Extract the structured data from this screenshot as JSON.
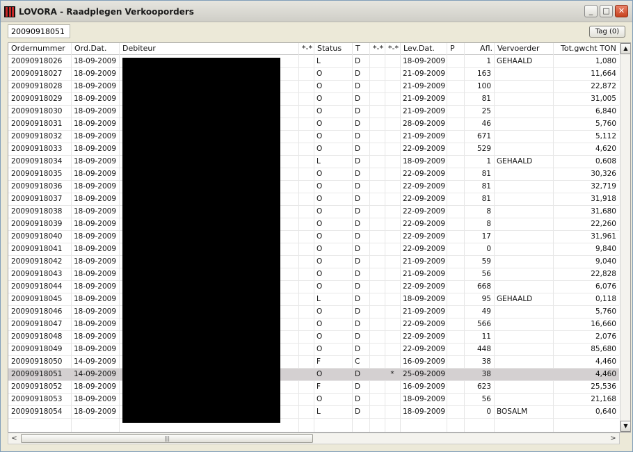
{
  "window": {
    "title": "LOVORA - Raadplegen Verkooporders",
    "min_label": "_",
    "max_label": "□",
    "close_label": "✕"
  },
  "search": {
    "value": "20090918051"
  },
  "toolbar": {
    "tag_label": "Tag (0)"
  },
  "columns": [
    "Ordernummer",
    "Ord.Dat.",
    "Debiteur",
    "*-*",
    "Status",
    "T",
    "*-*",
    "*-*",
    "Lev.Dat.",
    "P",
    "Afl.",
    "Vervoerder",
    "Tot.gwcht TON"
  ],
  "rows": [
    {
      "ordernummer": "20090918026",
      "orddat": "18-09-2009",
      "status": "L",
      "t": "D",
      "mark": "",
      "levdat": "18-09-2009",
      "afl": "1",
      "vervoerder": "GEHAALD",
      "gewicht": "1,080"
    },
    {
      "ordernummer": "20090918027",
      "orddat": "18-09-2009",
      "status": "O",
      "t": "D",
      "mark": "",
      "levdat": "21-09-2009",
      "afl": "163",
      "vervoerder": "",
      "gewicht": "11,664"
    },
    {
      "ordernummer": "20090918028",
      "orddat": "18-09-2009",
      "status": "O",
      "t": "D",
      "mark": "",
      "levdat": "21-09-2009",
      "afl": "100",
      "vervoerder": "",
      "gewicht": "22,872"
    },
    {
      "ordernummer": "20090918029",
      "orddat": "18-09-2009",
      "status": "O",
      "t": "D",
      "mark": "",
      "levdat": "21-09-2009",
      "afl": "81",
      "vervoerder": "",
      "gewicht": "31,005"
    },
    {
      "ordernummer": "20090918030",
      "orddat": "18-09-2009",
      "status": "O",
      "t": "D",
      "mark": "",
      "levdat": "21-09-2009",
      "afl": "25",
      "vervoerder": "",
      "gewicht": "6,840"
    },
    {
      "ordernummer": "20090918031",
      "orddat": "18-09-2009",
      "status": "O",
      "t": "D",
      "mark": "",
      "levdat": "28-09-2009",
      "afl": "46",
      "vervoerder": "",
      "gewicht": "5,760"
    },
    {
      "ordernummer": "20090918032",
      "orddat": "18-09-2009",
      "status": "O",
      "t": "D",
      "mark": "",
      "levdat": "21-09-2009",
      "afl": "671",
      "vervoerder": "",
      "gewicht": "5,112"
    },
    {
      "ordernummer": "20090918033",
      "orddat": "18-09-2009",
      "status": "O",
      "t": "D",
      "mark": "",
      "levdat": "22-09-2009",
      "afl": "529",
      "vervoerder": "",
      "gewicht": "4,620"
    },
    {
      "ordernummer": "20090918034",
      "orddat": "18-09-2009",
      "status": "L",
      "t": "D",
      "mark": "",
      "levdat": "18-09-2009",
      "afl": "1",
      "vervoerder": "GEHAALD",
      "gewicht": "0,608"
    },
    {
      "ordernummer": "20090918035",
      "orddat": "18-09-2009",
      "status": "O",
      "t": "D",
      "mark": "",
      "levdat": "22-09-2009",
      "afl": "81",
      "vervoerder": "",
      "gewicht": "30,326"
    },
    {
      "ordernummer": "20090918036",
      "orddat": "18-09-2009",
      "status": "O",
      "t": "D",
      "mark": "",
      "levdat": "22-09-2009",
      "afl": "81",
      "vervoerder": "",
      "gewicht": "32,719"
    },
    {
      "ordernummer": "20090918037",
      "orddat": "18-09-2009",
      "status": "O",
      "t": "D",
      "mark": "",
      "levdat": "22-09-2009",
      "afl": "81",
      "vervoerder": "",
      "gewicht": "31,918"
    },
    {
      "ordernummer": "20090918038",
      "orddat": "18-09-2009",
      "status": "O",
      "t": "D",
      "mark": "",
      "levdat": "22-09-2009",
      "afl": "8",
      "vervoerder": "",
      "gewicht": "31,680"
    },
    {
      "ordernummer": "20090918039",
      "orddat": "18-09-2009",
      "status": "O",
      "t": "D",
      "mark": "",
      "levdat": "22-09-2009",
      "afl": "8",
      "vervoerder": "",
      "gewicht": "22,260"
    },
    {
      "ordernummer": "20090918040",
      "orddat": "18-09-2009",
      "status": "O",
      "t": "D",
      "mark": "",
      "levdat": "22-09-2009",
      "afl": "17",
      "vervoerder": "",
      "gewicht": "31,961"
    },
    {
      "ordernummer": "20090918041",
      "orddat": "18-09-2009",
      "status": "O",
      "t": "D",
      "mark": "",
      "levdat": "22-09-2009",
      "afl": "0",
      "vervoerder": "",
      "gewicht": "9,840"
    },
    {
      "ordernummer": "20090918042",
      "orddat": "18-09-2009",
      "status": "O",
      "t": "D",
      "mark": "",
      "levdat": "21-09-2009",
      "afl": "59",
      "vervoerder": "",
      "gewicht": "9,040"
    },
    {
      "ordernummer": "20090918043",
      "orddat": "18-09-2009",
      "status": "O",
      "t": "D",
      "mark": "",
      "levdat": "21-09-2009",
      "afl": "56",
      "vervoerder": "",
      "gewicht": "22,828"
    },
    {
      "ordernummer": "20090918044",
      "orddat": "18-09-2009",
      "status": "O",
      "t": "D",
      "mark": "",
      "levdat": "22-09-2009",
      "afl": "668",
      "vervoerder": "",
      "gewicht": "6,076"
    },
    {
      "ordernummer": "20090918045",
      "orddat": "18-09-2009",
      "status": "L",
      "t": "D",
      "mark": "",
      "levdat": "18-09-2009",
      "afl": "95",
      "vervoerder": "GEHAALD",
      "gewicht": "0,118"
    },
    {
      "ordernummer": "20090918046",
      "orddat": "18-09-2009",
      "status": "O",
      "t": "D",
      "mark": "",
      "levdat": "21-09-2009",
      "afl": "49",
      "vervoerder": "",
      "gewicht": "5,760"
    },
    {
      "ordernummer": "20090918047",
      "orddat": "18-09-2009",
      "status": "O",
      "t": "D",
      "mark": "",
      "levdat": "22-09-2009",
      "afl": "566",
      "vervoerder": "",
      "gewicht": "16,660"
    },
    {
      "ordernummer": "20090918048",
      "orddat": "18-09-2009",
      "status": "O",
      "t": "D",
      "mark": "",
      "levdat": "22-09-2009",
      "afl": "11",
      "vervoerder": "",
      "gewicht": "2,076"
    },
    {
      "ordernummer": "20090918049",
      "orddat": "18-09-2009",
      "status": "O",
      "t": "D",
      "mark": "",
      "levdat": "22-09-2009",
      "afl": "448",
      "vervoerder": "",
      "gewicht": "85,680"
    },
    {
      "ordernummer": "20090918050",
      "orddat": "14-09-2009",
      "status": "F",
      "t": "C",
      "mark": "",
      "levdat": "16-09-2009",
      "afl": "38",
      "vervoerder": "",
      "gewicht": "4,460"
    },
    {
      "ordernummer": "20090918051",
      "orddat": "14-09-2009",
      "status": "O",
      "t": "D",
      "mark": "*",
      "levdat": "25-09-2009",
      "afl": "38",
      "vervoerder": "",
      "gewicht": "4,460",
      "selected": true
    },
    {
      "ordernummer": "20090918052",
      "orddat": "18-09-2009",
      "status": "F",
      "t": "D",
      "mark": "",
      "levdat": "16-09-2009",
      "afl": "623",
      "vervoerder": "",
      "gewicht": "25,536"
    },
    {
      "ordernummer": "20090918053",
      "orddat": "18-09-2009",
      "status": "O",
      "t": "D",
      "mark": "",
      "levdat": "18-09-2009",
      "afl": "56",
      "vervoerder": "",
      "gewicht": "21,168"
    },
    {
      "ordernummer": "20090918054",
      "orddat": "18-09-2009",
      "status": "L",
      "t": "D",
      "mark": "",
      "levdat": "18-09-2009",
      "afl": "0",
      "vervoerder": "BOSALM",
      "gewicht": "0,640"
    }
  ],
  "scroll": {
    "up_icon": "▲",
    "down_icon": "▼",
    "left_icon": "<",
    "right_icon": ">",
    "thumb_grip": "|||"
  }
}
